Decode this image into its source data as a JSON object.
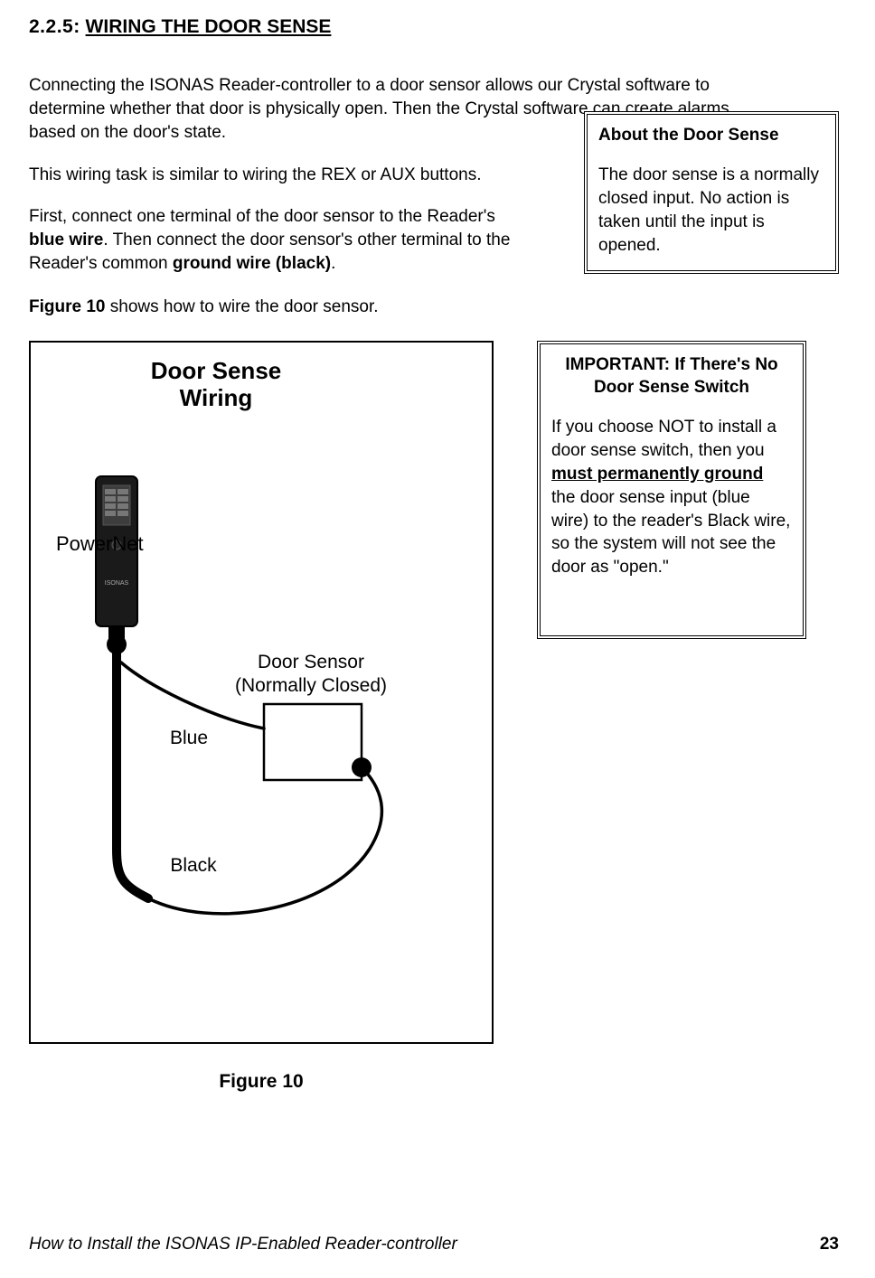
{
  "heading": {
    "number": "2.2.5:",
    "title": "WIRING THE DOOR SENSE"
  },
  "intro": {
    "p1a": "Connecting the ISONAS Reader-controller to a door sensor allows our Crystal software to determine whether that door is physically open. Then the Crystal software can create alarms based on the door's state.",
    "p1b": "This wiring task is similar to wiring the REX or AUX buttons.",
    "p2a": "First, connect one terminal of the door sensor to the Reader's ",
    "p2b": "blue wire",
    "p2c": ". Then connect the door sensor's other terminal to the Reader's common ",
    "p2d": "ground wire (black)",
    "p2e": ".",
    "p3a": "Figure 10",
    "p3b": " shows how to wire the door sensor."
  },
  "callout1": {
    "title": "About the Door Sense",
    "body": "The door sense is a normally closed input. No action is taken until the input is opened."
  },
  "callout2": {
    "title": "IMPORTANT: If There's No Door Sense Switch",
    "body_a": "If you choose NOT to install a door sense switch, then you ",
    "body_b": "must permanently ground",
    "body_c": " the door sense input (blue wire) to the reader's Black wire, so the system will not see the door as \"open.\""
  },
  "diagram": {
    "title1": "Door Sense",
    "title2": "Wiring",
    "label_powernet": "PowerNet",
    "label_sensor1": "Door Sensor",
    "label_sensor2": "(Normally Closed)",
    "label_blue": "Blue",
    "label_black": "Black"
  },
  "figure_caption": "Figure 10",
  "footer": {
    "left": "How to Install the ISONAS IP-Enabled Reader-controller",
    "page": "23"
  }
}
